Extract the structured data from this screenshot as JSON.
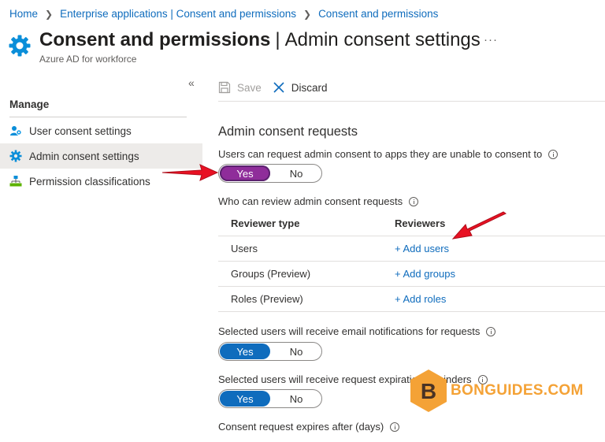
{
  "breadcrumb": {
    "items": [
      "Home",
      "Enterprise applications | Consent and permissions",
      "Consent and permissions"
    ]
  },
  "header": {
    "title_bold": "Consent and permissions",
    "title_separator": "|",
    "title_rest": "Admin consent settings",
    "subtitle": "Azure AD for workforce",
    "more_label": "···",
    "icon": "gear-icon"
  },
  "sidebar": {
    "collapse_label": "«",
    "section": "Manage",
    "items": [
      {
        "label": "User consent settings",
        "icon": "user-consent-icon",
        "active": false
      },
      {
        "label": "Admin consent settings",
        "icon": "gear-icon",
        "active": true
      },
      {
        "label": "Permission classifications",
        "icon": "hierarchy-icon",
        "active": false
      }
    ]
  },
  "toolbar": {
    "save_label": "Save",
    "discard_label": "Discard"
  },
  "main": {
    "section_title": "Admin consent requests",
    "request_label": "Users can request admin consent to apps they are unable to consent to",
    "request_toggle": {
      "yes": "Yes",
      "no": "No",
      "selected": "Yes"
    },
    "reviewers_label": "Who can review admin consent requests",
    "table": {
      "headers": [
        "Reviewer type",
        "Reviewers"
      ],
      "rows": [
        {
          "type": "Users",
          "action": "+ Add users"
        },
        {
          "type": "Groups (Preview)",
          "action": "+ Add groups"
        },
        {
          "type": "Roles (Preview)",
          "action": "+ Add roles"
        }
      ]
    },
    "email_label": "Selected users will receive email notifications for requests",
    "email_toggle": {
      "yes": "Yes",
      "no": "No",
      "selected": "Yes"
    },
    "expiry_label": "Selected users will receive request expiration reminders",
    "expiry_toggle": {
      "yes": "Yes",
      "no": "No",
      "selected": "Yes"
    },
    "expires_label": "Consent request expires after (days)"
  },
  "watermark": {
    "letter": "B",
    "text": "BONGUIDES.COM"
  },
  "colors": {
    "accent": "#0f6cbd",
    "highlight_toggle": "#8f2d9a",
    "arrow": "#e81123",
    "watermark": "#f4a236"
  }
}
